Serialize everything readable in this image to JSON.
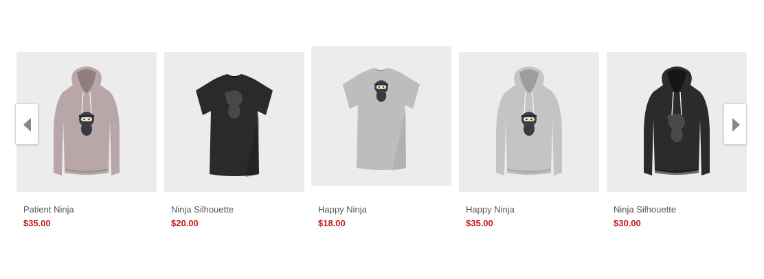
{
  "products": [
    {
      "name": "Patient Ninja",
      "price": "$35.00",
      "garment": "hoodie",
      "color": "#b9a6a8",
      "shade": "#8f7e80",
      "print": "ninja"
    },
    {
      "name": "Ninja Silhouette",
      "price": "$20.00",
      "garment": "tshirt",
      "color": "#2a2a2a",
      "shade": "#161616",
      "print": "silhouette"
    },
    {
      "name": "Happy Ninja",
      "price": "$18.00",
      "garment": "tshirt",
      "color": "#bdbdbd",
      "shade": "#9a9a9a",
      "print": "ninja"
    },
    {
      "name": "Happy Ninja",
      "price": "$35.00",
      "garment": "hoodie",
      "color": "#c4c4c4",
      "shade": "#9d9d9d",
      "print": "ninja"
    },
    {
      "name": "Ninja Silhouette",
      "price": "$30.00",
      "garment": "hoodie",
      "color": "#2b2b2b",
      "shade": "#151515",
      "print": "silhouette"
    }
  ],
  "controls": {
    "prev_icon": "chevron-left-icon",
    "next_icon": "chevron-right-icon",
    "arrow_color": "#888888"
  },
  "colors": {
    "price": "#c21a1a",
    "thumb_bg": "#ececec"
  }
}
